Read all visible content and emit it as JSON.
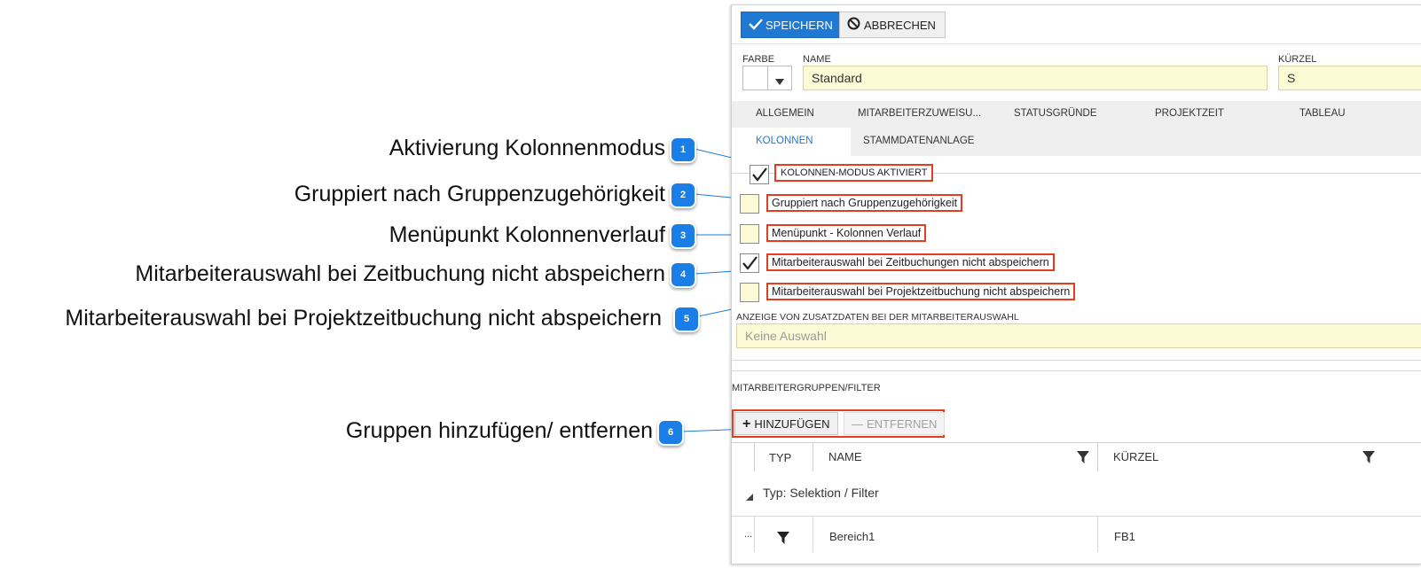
{
  "toolbar": {
    "save_label": "SPEICHERN",
    "cancel_label": "ABBRECHEN"
  },
  "form": {
    "color_label": "FARBE",
    "name_label": "NAME",
    "name_value": "Standard",
    "short_label": "KÜRZEL",
    "short_value": "S"
  },
  "tabs": {
    "row1": [
      "ALLGEMEIN",
      "MITARBEITERZUWEISU...",
      "STATUSGRÜNDE",
      "PROJEKTZEIT",
      "TABLEAU"
    ],
    "row2": [
      "KOLONNEN",
      "STAMMDATENANLAGE"
    ],
    "active": "KOLONNEN"
  },
  "options": {
    "kolonnen_mode": {
      "label": "KOLONNEN-MODUS AKTIVIERT",
      "checked": true
    },
    "grouped": {
      "label": "Gruppiert nach Gruppenzugehörigkeit",
      "checked": false
    },
    "menu_item": {
      "label": "Menüpunkt - Kolonnen Verlauf",
      "checked": false
    },
    "no_save_time": {
      "label": "Mitarbeiterauswahl bei Zeitbuchungen nicht abspeichern",
      "checked": true
    },
    "no_save_project": {
      "label": "Mitarbeiterauswahl bei Projektzeitbuchung nicht abspeichern",
      "checked": false
    }
  },
  "extra_data": {
    "label": "ANZEIGE VON ZUSATZDATEN BEI DER MITARBEITERAUSWAHL",
    "placeholder": "Keine Auswahl"
  },
  "groups": {
    "section_label": "MITARBEITERGRUPPEN/FILTER",
    "add_label": "HINZUFÜGEN",
    "remove_label": "ENTFERNEN",
    "columns": [
      "TYP",
      "NAME",
      "KÜRZEL"
    ],
    "group_header": "Typ: Selektion / Filter",
    "rows": [
      {
        "dots": "...",
        "name": "Bereich1",
        "short": "FB1"
      }
    ]
  },
  "callouts": [
    {
      "num": "1",
      "text": "Aktivierung Kolonnenmodus"
    },
    {
      "num": "2",
      "text": "Gruppiert nach Gruppenzugehörigkeit"
    },
    {
      "num": "3",
      "text": "Menüpunkt Kolonnenverlauf"
    },
    {
      "num": "4",
      "text": "Mitarbeiterauswahl bei Zeitbuchung nicht abspeichern"
    },
    {
      "num": "5",
      "text": "Mitarbeiterauswahl bei Projektzeitbuchung nicht abspeichern"
    },
    {
      "num": "6",
      "text": "Gruppen hinzufügen/ entfernen"
    }
  ],
  "colors": {
    "primary": "#1f78d1",
    "badge": "#1a7ee6",
    "highlight": "#e53b1f",
    "field_bg": "#fdfbd6",
    "active_tab": "#1f78d1"
  }
}
